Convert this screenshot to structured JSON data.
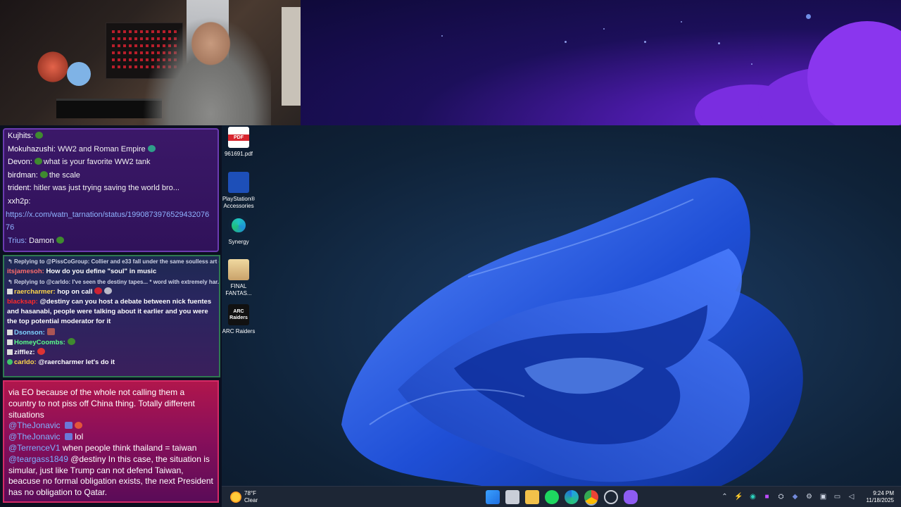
{
  "chat_top": {
    "lines": [
      {
        "user": "Kujhits:",
        "text": ""
      },
      {
        "user": "Mokuhazushi:",
        "text": "WW2 and Roman Empire"
      },
      {
        "user": "Devon:",
        "text": "what is your favorite WW2 tank"
      },
      {
        "user": "birdman:",
        "text": "the scale"
      },
      {
        "user": "trident:",
        "text": "hitler was just trying saving the world bro..."
      },
      {
        "user": "xxh2p:",
        "text": ""
      }
    ],
    "link_line1": "https://x.com/watn_tarnation/status/1990873976529432076",
    "link_line2": "76",
    "last_user": "Trius:",
    "last_text": "Damon"
  },
  "chat_mid": {
    "reply1": "Replying to @PissCoGroup: Collier and e33 fall under the same soulless art c...",
    "msg1_user": "itsjamesoh:",
    "msg1_text": "How do you define \"soul\" in music",
    "reply2": "Replying to @carldo: I've seen the destiny tapes... * word with extremely har...",
    "msg2_user": "raercharmer:",
    "msg2_text": "hop on call",
    "msg3_user": "blacksap:",
    "msg3_text": "@destiny can you host a debate between nick fuentes and hasanabi, people were talking about it earlier and you were the top potential moderator for it",
    "msg4_user": "Dsonson:",
    "msg5_user": "HomeyCoombs:",
    "msg6_user": "zifflez:",
    "msg7_user": "carldo:",
    "msg7_text": "@raercharmer let's do it"
  },
  "chat_bottom": {
    "para1": "via EO because of the whole not calling them a country to not piss off China thing. Totally different situations",
    "mention1": "@TheJonavic",
    "mention2": "@TheJonavic",
    "mention2_text": "lol",
    "mention3": "@TerrenceV1",
    "mention3_text": "when people think thailand = taiwan",
    "mention4": "@teargass1849",
    "mention4_text": "@destiny In this case, the situation is simular, just like Trump can not defend Taiwan, beacuse no formal obligation exists, the next President has no obligation to Qatar."
  },
  "desktop": {
    "icons": [
      {
        "label": "961691.pdf",
        "glyph": "PDF"
      },
      {
        "label": "PlayStation® Accessories",
        "glyph": ""
      },
      {
        "label": "Synergy",
        "glyph": ""
      },
      {
        "label": "FINAL FANTAS...",
        "glyph": ""
      },
      {
        "label": "ARC Raiders",
        "glyph": "ARC Raiders"
      }
    ]
  },
  "taskbar": {
    "weather_temp": "78°F",
    "weather_desc": "Clear",
    "apps": [
      "start-icon",
      "task-view-icon",
      "file-explorer-icon",
      "spotify-icon",
      "edge-icon",
      "chrome-icon",
      "obs-icon",
      "app-icon"
    ],
    "time": "9:24 PM",
    "date": "11/18/2025"
  },
  "colors": {
    "accent_purple": "#6b3bb0",
    "accent_pink": "#d42a66",
    "windows_blue": "#1f4fd6"
  }
}
